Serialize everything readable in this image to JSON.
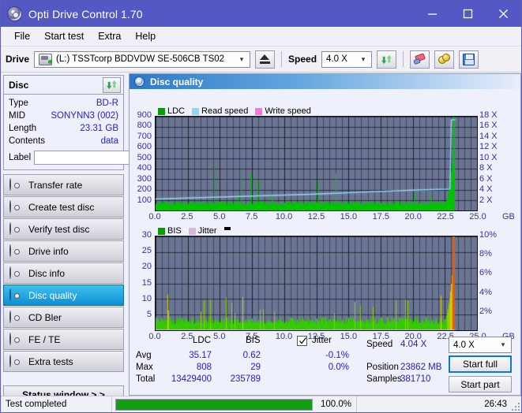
{
  "window": {
    "title": "Opti Drive Control 1.70",
    "icon": "disc-icon",
    "minimize": "minimize",
    "maximize": "maximize",
    "close": "close"
  },
  "menu": [
    "File",
    "Start test",
    "Extra",
    "Help"
  ],
  "toolbar": {
    "drive_label": "Drive",
    "drive_value": "(L:)  TSSTcorp BDDVDW SE-506CB TS02",
    "eject_icon": "eject-icon",
    "speed_label": "Speed",
    "speed_value": "4.0 X",
    "refresh_icon": "refresh-icon",
    "erase_icon": "eraser-icon",
    "coins_icon": "coins-icon",
    "save_icon": "save-icon"
  },
  "disc": {
    "header": "Disc",
    "refresh_icon": "refresh-icon",
    "rows": [
      {
        "key": "Type",
        "value": "BD-R"
      },
      {
        "key": "MID",
        "value": "SONYNN3 (002)"
      },
      {
        "key": "Length",
        "value": "23.31 GB"
      },
      {
        "key": "Contents",
        "value": "data"
      }
    ],
    "label_key": "Label",
    "label_value": "",
    "label_placeholder": "",
    "label_button_icon": "disc-icon"
  },
  "nav": {
    "items": [
      {
        "label": "Transfer rate",
        "icon": "disc-icon",
        "active": false
      },
      {
        "label": "Create test disc",
        "icon": "disc-icon",
        "active": false
      },
      {
        "label": "Verify test disc",
        "icon": "disc-icon",
        "active": false
      },
      {
        "label": "Drive info",
        "icon": "disc-icon",
        "active": false
      },
      {
        "label": "Disc info",
        "icon": "disc-icon",
        "active": false
      },
      {
        "label": "Disc quality",
        "icon": "disc-icon",
        "active": true
      },
      {
        "label": "CD Bler",
        "icon": "disc-icon",
        "active": false
      },
      {
        "label": "FE / TE",
        "icon": "disc-icon",
        "active": false
      },
      {
        "label": "Extra tests",
        "icon": "disc-icon",
        "active": false
      }
    ],
    "status_window": "Status window > >"
  },
  "panel": {
    "title": "Disc quality",
    "icon": "disc-icon"
  },
  "stats": {
    "columns": [
      "LDC",
      "BIS"
    ],
    "rows": [
      {
        "key": "Avg",
        "ldc": "35.17",
        "bis": "0.62",
        "jitter": "-0.1%"
      },
      {
        "key": "Max",
        "ldc": "808",
        "bis": "29",
        "jitter": "0.0%"
      },
      {
        "key": "Total",
        "ldc": "13429400",
        "bis": "235789",
        "jitter": ""
      }
    ],
    "jitter_label": "Jitter",
    "jitter_checked": true,
    "speed_key": "Speed",
    "speed_value": "4.04 X",
    "position_key": "Position",
    "position_value": "23862 MB",
    "samples_key": "Samples",
    "samples_value": "381710",
    "speed_select": "4.0 X",
    "start_full": "Start full",
    "start_part": "Start part"
  },
  "statusbar": {
    "message": "Test completed",
    "progress_text": "100.0%",
    "progress_value": 100,
    "elapsed": "26:43"
  },
  "colors": {
    "accent": "#5458c4",
    "ldc_green": "#00c400",
    "read_speed": "#8fd8f5",
    "write_speed": "#ff72e0",
    "jitter": "#d9b7d9",
    "plot_bg": "#6a7593",
    "value_blue": "#2222cc",
    "progress_green": "#12a012"
  },
  "chart_data": [
    {
      "type": "area",
      "name": "ldc-chart",
      "title": "Disc quality",
      "legend": [
        {
          "label": "LDC",
          "color": "#00a000"
        },
        {
          "label": "Read speed",
          "color": "#8fd8f5"
        },
        {
          "label": "Write speed",
          "color": "#ff72e0"
        }
      ],
      "legend_position": "top-left",
      "xlabel": "GB",
      "ylabel": "LDC",
      "xlim": [
        0,
        25.0
      ],
      "ylim": [
        0,
        900
      ],
      "xticks": [
        0.0,
        2.5,
        5.0,
        7.5,
        10.0,
        12.5,
        15.0,
        17.5,
        20.0,
        22.5,
        25.0
      ],
      "xtick_labels": [
        "0.0",
        "2.5",
        "5.0",
        "7.5",
        "10.0",
        "12.5",
        "15.0",
        "17.5",
        "20.0",
        "22.5",
        "25.0"
      ],
      "yticks": [
        100,
        200,
        300,
        400,
        500,
        600,
        700,
        800,
        900
      ],
      "ytick_labels": [
        "100",
        "200",
        "300",
        "400",
        "500",
        "600",
        "700",
        "800",
        "900"
      ],
      "y2lim": [
        0,
        18
      ],
      "y2ticks": [
        2,
        4,
        6,
        8,
        10,
        12,
        14,
        16,
        18
      ],
      "y2tick_labels": [
        "2 X",
        "4 X",
        "6 X",
        "8 X",
        "10 X",
        "12 X",
        "14 X",
        "16 X",
        "18 X"
      ],
      "grid": true,
      "data_end_x": 23.31,
      "series": [
        {
          "name": "LDC",
          "color": "#00c400",
          "kind": "spiky-area",
          "baseline": 55,
          "noise": 35,
          "spike_rate": 0.045,
          "spike_max": 380,
          "end_ramp_start_x": 22.3,
          "end_ramp_peak": 820
        },
        {
          "name": "Read speed",
          "color": "#8fd8f5",
          "kind": "line",
          "points": [
            [
              0.0,
              2.2
            ],
            [
              2.0,
              2.35
            ],
            [
              4.0,
              2.5
            ],
            [
              6.0,
              2.65
            ],
            [
              8.0,
              2.8
            ],
            [
              10.0,
              2.95
            ],
            [
              12.0,
              3.1
            ],
            [
              14.0,
              3.3
            ],
            [
              16.0,
              3.5
            ],
            [
              18.0,
              3.7
            ],
            [
              20.0,
              3.9
            ],
            [
              22.0,
              4.05
            ],
            [
              22.9,
              4.1
            ],
            [
              23.0,
              17.4
            ],
            [
              23.31,
              17.4
            ]
          ]
        }
      ]
    },
    {
      "type": "area",
      "name": "bis-chart",
      "legend": [
        {
          "label": "BIS",
          "color": "#00a000"
        },
        {
          "label": "Jitter",
          "color": "#d9b7d9"
        }
      ],
      "legend_position": "top-left",
      "xlabel": "GB",
      "ylabel": "BIS",
      "xlim": [
        0,
        25.0
      ],
      "ylim": [
        0,
        30
      ],
      "xticks": [
        0.0,
        2.5,
        5.0,
        7.5,
        10.0,
        12.5,
        15.0,
        17.5,
        20.0,
        22.5,
        25.0
      ],
      "xtick_labels": [
        "0.0",
        "2.5",
        "5.0",
        "7.5",
        "10.0",
        "12.5",
        "15.0",
        "17.5",
        "20.0",
        "22.5",
        "25.0"
      ],
      "yticks": [
        5,
        10,
        15,
        20,
        25,
        30
      ],
      "ytick_labels": [
        "5",
        "10",
        "15",
        "20",
        "25",
        "30"
      ],
      "y2lim": [
        0,
        10
      ],
      "y2ticks": [
        2,
        4,
        6,
        8,
        10
      ],
      "y2tick_labels": [
        "2%",
        "4%",
        "6%",
        "8%",
        "10%"
      ],
      "grid": true,
      "data_end_x": 23.31,
      "series": [
        {
          "name": "BIS",
          "color": "#33cc00",
          "kind": "spiky-area",
          "baseline": 2.0,
          "noise": 2.2,
          "spike_rate": 0.05,
          "spike_max": 9.5,
          "end_ramp_start_x": 22.2,
          "end_ramp_peak": 30
        },
        {
          "name": "Jitter",
          "color": "#d9b7d9",
          "kind": "line",
          "points": [
            [
              0.0,
              0.0
            ],
            [
              23.31,
              0.0
            ]
          ]
        }
      ]
    }
  ]
}
